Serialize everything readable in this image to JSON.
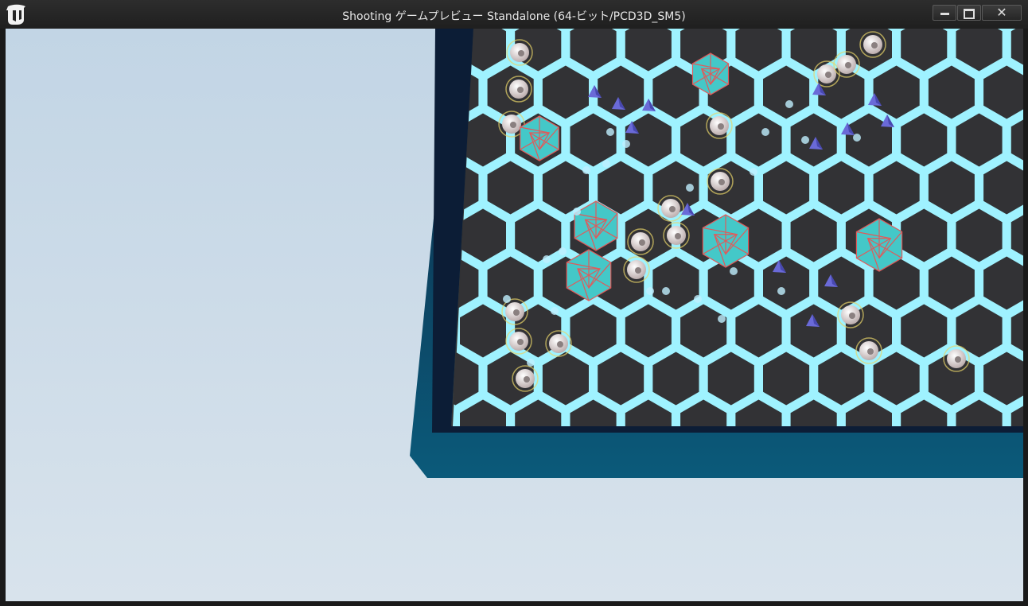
{
  "window": {
    "title": "Shooting ゲームプレビュー Standalone (64-ビット/PCD3D_SM5)",
    "minimize_glyph": "—",
    "maximize_glyph": "☐",
    "close_glyph": "✕"
  },
  "icons": [
    "unreal-engine-logo-icon",
    "minimize-icon",
    "maximize-icon",
    "close-icon"
  ],
  "colors": {
    "sky": "#c9d9e7",
    "arena_wall": "#10203a",
    "arena_wall_edge": "#0a4a6a",
    "floor_tile": "#3a3a3c",
    "hex_glow": "#9ff2ff",
    "player": "#44c8c8",
    "enemy": "#6a6ad8",
    "coin": "#e8dede"
  },
  "scene": {
    "description_counts": {
      "players": 6,
      "enemies": 14,
      "coins": 20
    }
  }
}
